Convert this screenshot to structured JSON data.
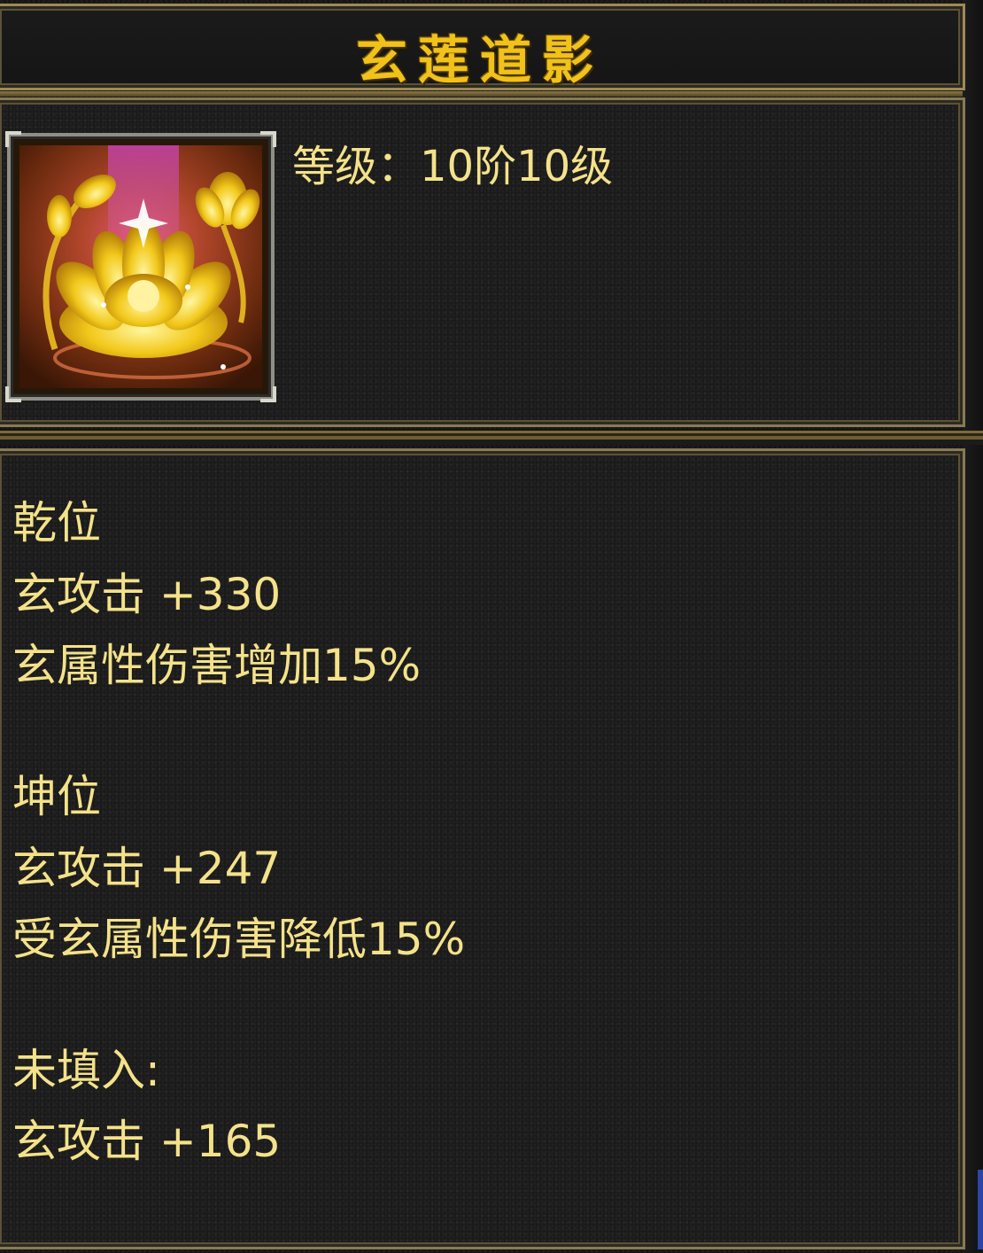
{
  "title": "玄莲道影",
  "item": {
    "icon": "golden-lotus-icon",
    "level_text": "等级：10阶10级"
  },
  "stats": [
    "乾位",
    "玄攻击 +330",
    "玄属性伤害增加15%",
    "坤位",
    "玄攻击 +247",
    "受玄属性伤害降低15%",
    "未填入:",
    "玄攻击 +165"
  ],
  "colors": {
    "title": "#f0c21a",
    "text": "#f4e28a",
    "border": "#8a7a52",
    "background": "#141414"
  }
}
